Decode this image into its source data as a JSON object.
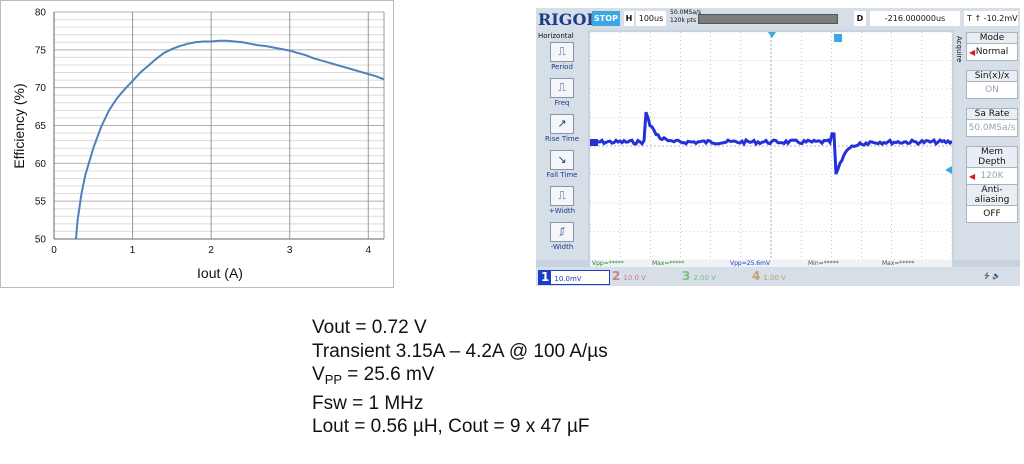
{
  "chart_data": {
    "type": "line",
    "title": "",
    "xlabel": "Iout (A)",
    "ylabel": "Efficiency (%)",
    "xlim": [
      0,
      4.2
    ],
    "ylim": [
      50,
      80
    ],
    "x_ticks": [
      0,
      1,
      2,
      3,
      4
    ],
    "y_ticks": [
      50,
      55,
      60,
      65,
      70,
      75,
      80
    ],
    "grid": "vertical major + horizontal minor",
    "series": [
      {
        "color": "#4f81bd",
        "x": [
          0.28,
          0.3,
          0.35,
          0.4,
          0.5,
          0.6,
          0.7,
          0.8,
          0.9,
          1.0,
          1.1,
          1.2,
          1.3,
          1.4,
          1.5,
          1.6,
          1.7,
          1.8,
          1.9,
          2.0,
          2.1,
          2.2,
          2.3,
          2.4,
          2.5,
          2.6,
          2.7,
          2.8,
          2.9,
          3.0,
          3.1,
          3.2,
          3.3,
          3.4,
          3.5,
          3.6,
          3.7,
          3.8,
          3.9,
          4.0,
          4.1,
          4.2
        ],
        "y": [
          50.0,
          52.5,
          56.0,
          58.5,
          62.0,
          64.8,
          67.0,
          68.6,
          69.8,
          70.9,
          72.0,
          72.9,
          73.8,
          74.6,
          75.1,
          75.5,
          75.8,
          76.0,
          76.1,
          76.1,
          76.2,
          76.2,
          76.1,
          76.0,
          75.8,
          75.6,
          75.5,
          75.3,
          75.1,
          74.9,
          74.6,
          74.3,
          73.9,
          73.6,
          73.3,
          73.0,
          72.7,
          72.4,
          72.1,
          71.8,
          71.5,
          71.1
        ]
      }
    ]
  },
  "scope": {
    "brand": "RIGOL",
    "status": "STOP",
    "timebase_label": "H",
    "timebase": "100us",
    "sample_rate_line1": "50.0MSa/s",
    "sample_rate_line2": "120k pts",
    "delay_label": "D",
    "delay": "-216.000000us",
    "trigger_label": "T",
    "trigger_level": "-10.2mV",
    "left_menu_title": "Horizontal",
    "left_menu": [
      "Period",
      "Freq",
      "Rise Time",
      "Fall Time",
      "+Width",
      "-Width"
    ],
    "acquire_tab": "Acquire",
    "right_menu": [
      {
        "title": "Mode",
        "value": "Normal"
      },
      {
        "title": "Sin(x)/x",
        "value": "ON"
      },
      {
        "title": "Sa Rate",
        "value": "50.0MSa/s"
      },
      {
        "title": "Mem Depth",
        "value": "120K"
      },
      {
        "title": "Anti-aliasing",
        "value": "OFF"
      }
    ],
    "measurements": [
      "Vpp=*****",
      "Max=*****",
      "Vpp=25.6mV",
      "Min=*****",
      "Max=*****"
    ],
    "channels": [
      {
        "num": "1",
        "scale": "10.0mV"
      },
      {
        "num": "2",
        "scale": "10.0 V"
      },
      {
        "num": "3",
        "scale": "2.00 V"
      },
      {
        "num": "4",
        "scale": "1.00 V"
      }
    ],
    "trace_color": "#2430d8",
    "grid_color": "#9aa3ad"
  },
  "specs": {
    "vout": "Vout = 0.72 V",
    "transient": "Transient 3.15A – 4.2A @ 100 A/µs",
    "vpp_main": "V",
    "vpp_sub": "PP",
    "vpp_value": " = 25.6 mV",
    "fsw": "Fsw = 1 MHz",
    "lc": "Lout = 0.56 µH, Cout = 9 x 47 µF"
  }
}
